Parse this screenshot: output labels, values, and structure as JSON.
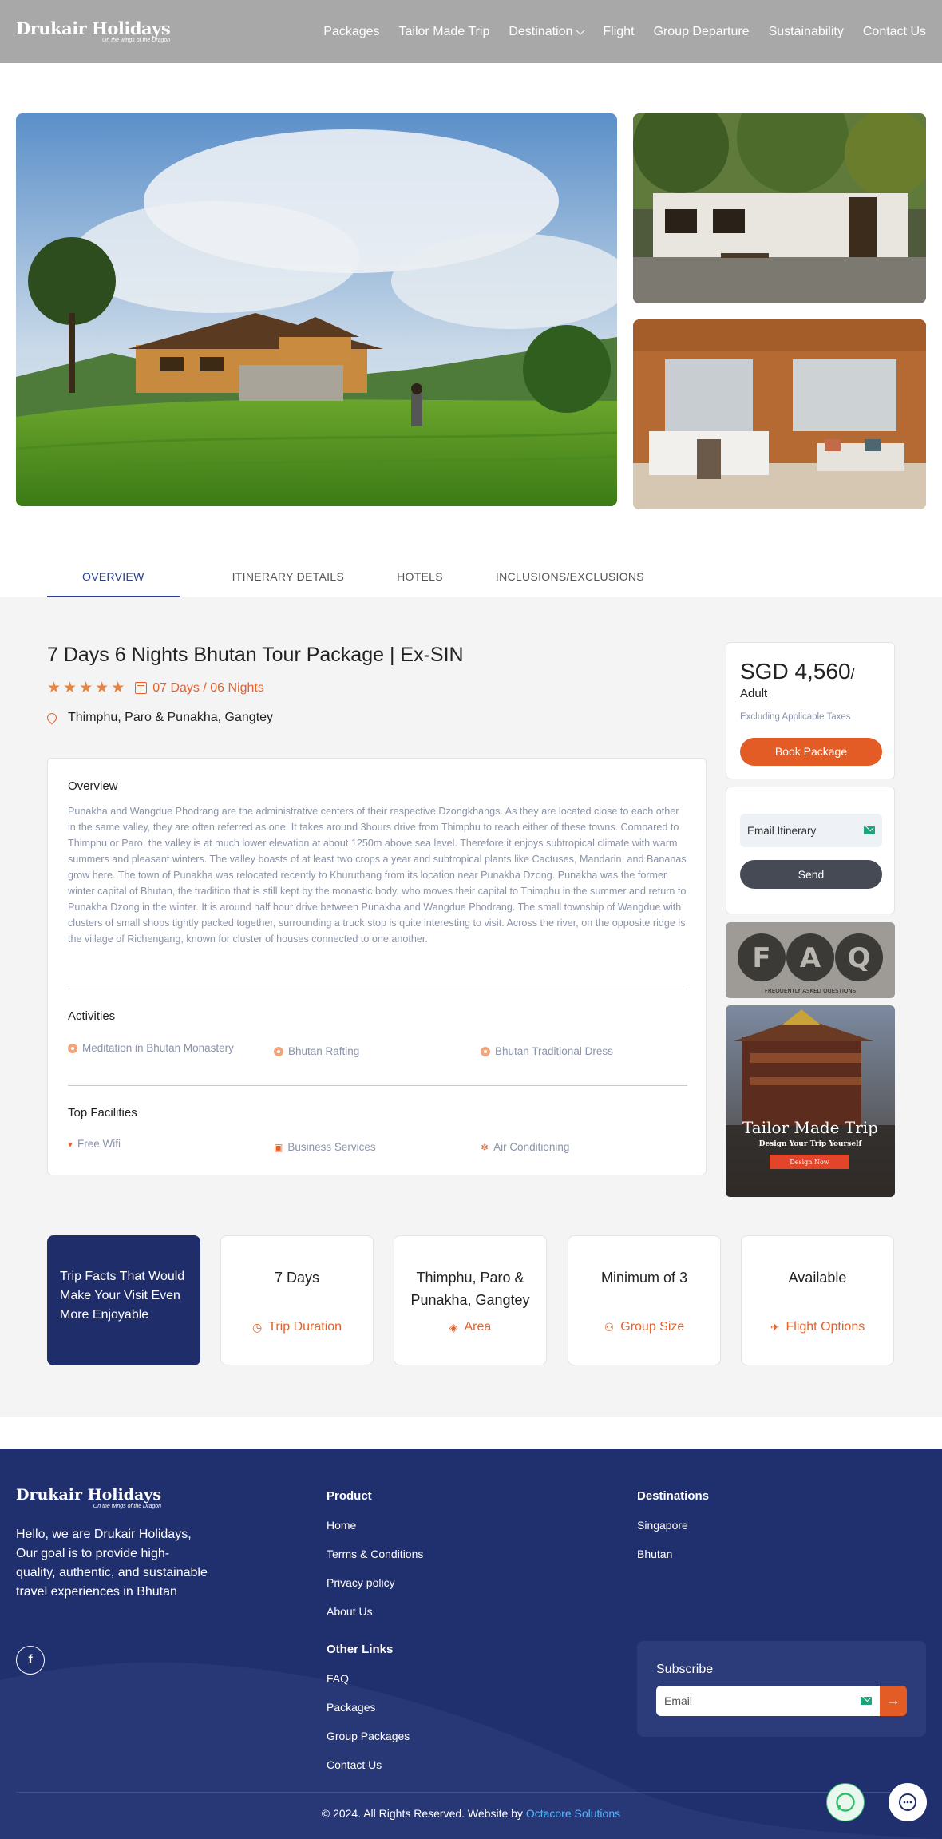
{
  "header": {
    "brand": "Drukair Holidays",
    "tagline": "On the wings of the Dragon",
    "nav": [
      {
        "label": "Packages"
      },
      {
        "label": "Tailor Made Trip"
      },
      {
        "label": "Destination"
      },
      {
        "label": "Flight"
      },
      {
        "label": "Group Departure"
      },
      {
        "label": "Sustainability"
      },
      {
        "label": "Contact Us"
      }
    ]
  },
  "tabs": [
    "OVERVIEW",
    "ITINERARY DETAILS",
    "HOTELS",
    "INCLUSIONS/EXCLUSIONS"
  ],
  "package": {
    "title": "7 Days 6 Nights Bhutan Tour Package | Ex-SIN",
    "rating": 5,
    "duration": "07 Days / 06 Nights",
    "location": "Thimphu, Paro & Punakha, Gangtey"
  },
  "overview": {
    "title": "Overview",
    "text": "Punakha and Wangdue Phodrang are the administrative centers of their respective Dzongkhangs. As they are located close to each other in the same valley, they are often referred as one. It takes around 3hours drive from Thimphu to reach either of these towns. Compared to Thimphu or Paro, the valley is at much lower elevation at about 1250m above sea level. Therefore it enjoys subtropical climate with warm summers and pleasant winters. The valley boasts of at least two crops a year and subtropical plants like Cactuses, Mandarin, and Bananas grow here. The town of Punakha was relocated recently to Khuruthang from its location near Punakha Dzong. Punakha was the former winter capital of Bhutan, the tradition that is still kept by the monastic body, who moves their capital to Thimphu in the summer and return to Punakha Dzong in the winter. It is around half hour drive between Punakha and Wangdue Phodrang. The small township of Wangdue with clusters of small shops tightly packed together, surrounding a truck stop is quite interesting to visit. Across the river, on the opposite ridge is the village of Richengang, known for cluster of houses connected to one another."
  },
  "activities": {
    "title": "Activities",
    "items": [
      "Meditation in Bhutan Monastery",
      "Bhutan Rafting",
      "Bhutan Traditional Dress"
    ]
  },
  "facilities": {
    "title": "Top Facilities",
    "items": [
      "Free Wifi",
      "Business Services",
      "Air Conditioning"
    ]
  },
  "pricing": {
    "amount": "SGD 4,560",
    "per": "/",
    "unit": "Adult",
    "note": "Excluding Applicable Taxes",
    "book_label": "Book Package"
  },
  "email_itinerary": {
    "placeholder": "Email Itinerary",
    "send_label": "Send"
  },
  "promo": {
    "faq_text": "FAQ",
    "faq_sub": "FREQUENTLY ASKED QUESTIONS",
    "tmt_title": "Tailor Made Trip",
    "tmt_sub": "Design Your Trip Yourself",
    "tmt_btn": "Design Now"
  },
  "trip_facts": {
    "lead": "Trip Facts That Would Make Your Visit Even More Enjoyable",
    "items": [
      {
        "value": "7 Days",
        "label": "Trip Duration",
        "icon": "clock-icon"
      },
      {
        "value": "Thimphu, Paro & Punakha, Gangtey",
        "label": "Area",
        "icon": "location-icon"
      },
      {
        "value": "Minimum of 3",
        "label": "Group Size",
        "icon": "group-icon"
      },
      {
        "value": "Available",
        "label": "Flight Options",
        "icon": "plane-icon"
      }
    ]
  },
  "footer": {
    "brand": "Drukair Holidays",
    "tagline": "On the wings of the Dragon",
    "about": "Hello, we are Drukair Holidays, Our goal is to provide high-quality, authentic, and sustainable travel experiences in Bhutan",
    "product_title": "Product",
    "product_links": [
      "Home",
      "Terms & Conditions",
      "Privacy policy",
      "About Us"
    ],
    "other_title": "Other Links",
    "other_links": [
      "FAQ",
      "Packages",
      "Group Packages",
      "Contact Us"
    ],
    "dest_title": "Destinations",
    "dest_links": [
      "Singapore",
      "Bhutan"
    ],
    "subscribe_title": "Subscribe",
    "subscribe_placeholder": "Email",
    "copyright": "© 2024. All Rights Reserved. Website by ",
    "credit": "Octacore Solutions"
  },
  "colors": {
    "accent": "#e35c25",
    "navy": "#1f2d6b",
    "header_bg": "#a8a8a8"
  }
}
